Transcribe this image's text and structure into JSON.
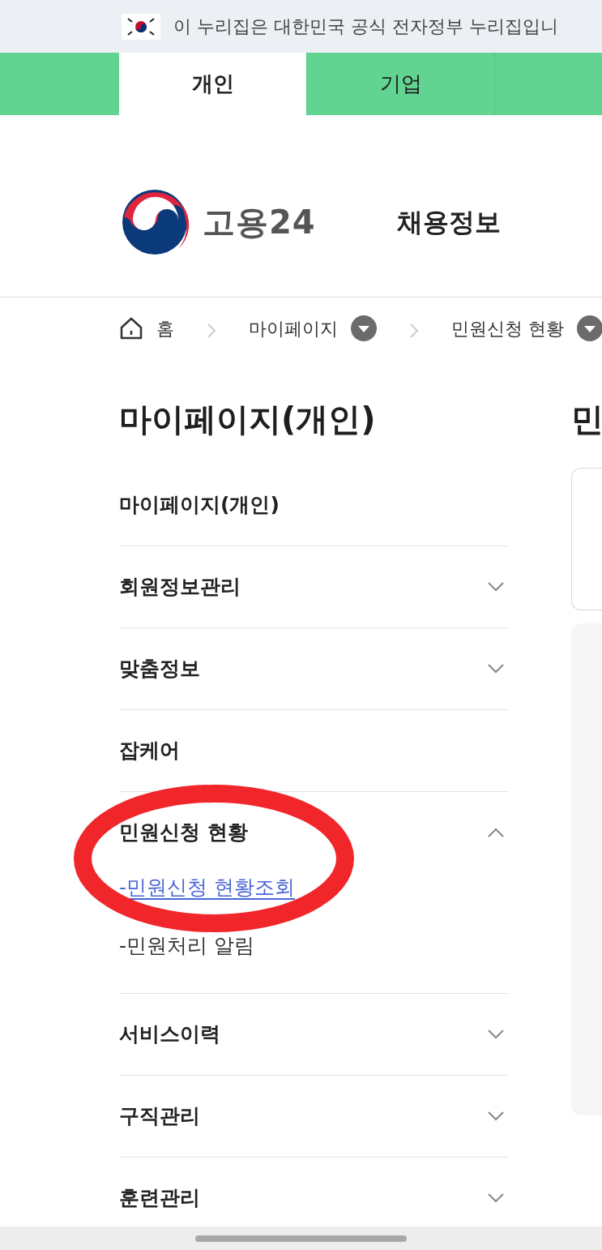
{
  "gov_banner": {
    "text": "이 누리집은 대한민국 공식 전자정부 누리집입니"
  },
  "tabs": [
    {
      "label": "개인",
      "selected": true
    },
    {
      "label": "기업",
      "selected": false
    }
  ],
  "header": {
    "logo_text": "고용24",
    "nav": [
      "채용정보"
    ]
  },
  "breadcrumb": [
    {
      "label": "홈",
      "kind": "home"
    },
    {
      "label": "마이페이지",
      "kind": "dropdown"
    },
    {
      "label": "민원신청 현황",
      "kind": "dropdown"
    }
  ],
  "sidebar": {
    "title": "마이페이지(개인)",
    "items": [
      {
        "label": "마이페이지(개인)",
        "kind": "link"
      },
      {
        "label": "회원정보관리",
        "kind": "group",
        "expanded": false
      },
      {
        "label": "맞춤정보",
        "kind": "group",
        "expanded": false
      },
      {
        "label": "잡케어",
        "kind": "link"
      },
      {
        "label": "민원신청 현황",
        "kind": "group",
        "expanded": true,
        "children": [
          {
            "label": "-민원신청 현황조회",
            "selected": true
          },
          {
            "label": "-민원처리 알림",
            "selected": false
          }
        ]
      },
      {
        "label": "서비스이력",
        "kind": "group",
        "expanded": false
      },
      {
        "label": "구직관리",
        "kind": "group",
        "expanded": false
      },
      {
        "label": "훈련관리",
        "kind": "group",
        "expanded": false
      }
    ]
  },
  "content": {
    "title": "민"
  }
}
